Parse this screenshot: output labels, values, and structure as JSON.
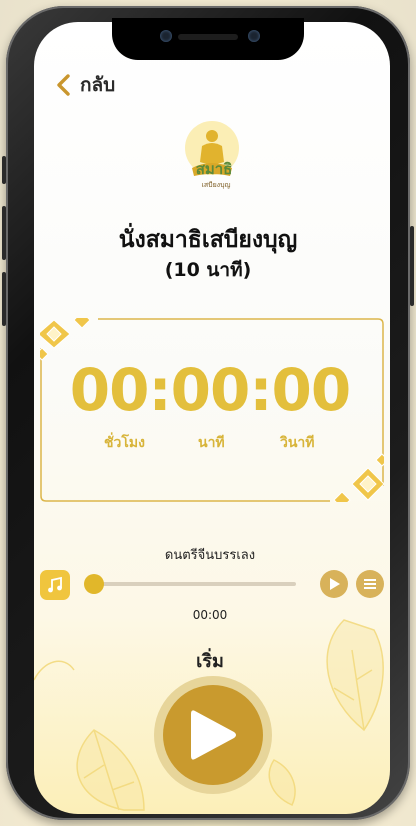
{
  "header": {
    "back_label": "กลับ"
  },
  "logo": {
    "caption": "สมาธิ",
    "sub_caption": "เสบียงบุญ"
  },
  "session": {
    "title": "นั่งสมาธิเสบียงบุญ",
    "duration": "(10 นาที)"
  },
  "timer": {
    "display": "00:00:00",
    "units": {
      "hours": "ชั่วโมง",
      "minutes": "นาที",
      "seconds": "วินาที"
    }
  },
  "music": {
    "track_name": "ดนตรีจีนบรรเลง",
    "elapsed": "00:00",
    "progress": 0
  },
  "start": {
    "label": "เริ่ม"
  },
  "colors": {
    "accent_gold": "#e3bf3c",
    "button_gold": "#c99a2e"
  }
}
